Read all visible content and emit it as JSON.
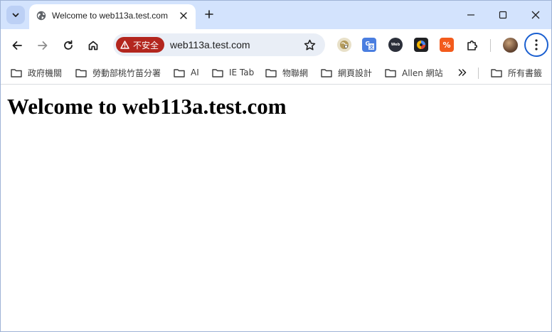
{
  "tab": {
    "title": "Welcome to web113a.test.com"
  },
  "toolbar": {
    "security_label": "不安全",
    "url": "web113a.test.com"
  },
  "bookmarks": [
    {
      "label": "政府機關"
    },
    {
      "label": "勞動部桃竹苗分署"
    },
    {
      "label": "AI"
    },
    {
      "label": "IE Tab"
    },
    {
      "label": "物聯網"
    },
    {
      "label": "網頁設計"
    },
    {
      "label": "Allen 網站"
    }
  ],
  "all_bookmarks_label": "所有書籤",
  "page": {
    "heading": "Welcome to web113a.test.com"
  },
  "colors": {
    "tabstrip_bg": "#d3e3fd",
    "omnibox_bg": "#e9eef6",
    "insecure_badge": "#b3261e",
    "menu_ring": "#1a5fd0"
  },
  "icons": {
    "tab_search": "chevron-down-icon",
    "favicon": "globe-icon",
    "close": "close-icon",
    "new_tab": "plus-icon",
    "back": "arrow-left-icon",
    "forward": "arrow-right-icon",
    "reload": "reload-icon",
    "home": "home-icon",
    "warning": "warning-triangle-icon",
    "bookmark_star": "star-icon",
    "extensions": "puzzle-icon",
    "menu": "kebab-menu-icon",
    "folder": "folder-icon",
    "overflow": "double-chevron-right-icon"
  }
}
